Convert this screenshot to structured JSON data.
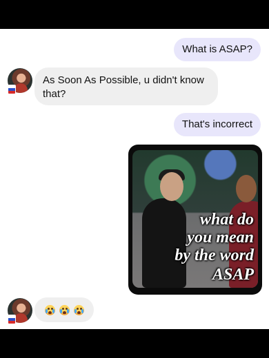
{
  "messages": {
    "m1": "What is ASAP?",
    "m2": "As Soon As Possible, u didn't know that?",
    "m3": "That's incorrect",
    "media_caption": [
      "what do",
      "you mean",
      "by the word",
      "ASAP"
    ]
  },
  "reaction": {
    "emojis": [
      "crying-face",
      "crying-face",
      "crying-face"
    ]
  },
  "colors": {
    "outgoing_bubble": "#e8e6fb",
    "incoming_bubble": "#efefef"
  }
}
